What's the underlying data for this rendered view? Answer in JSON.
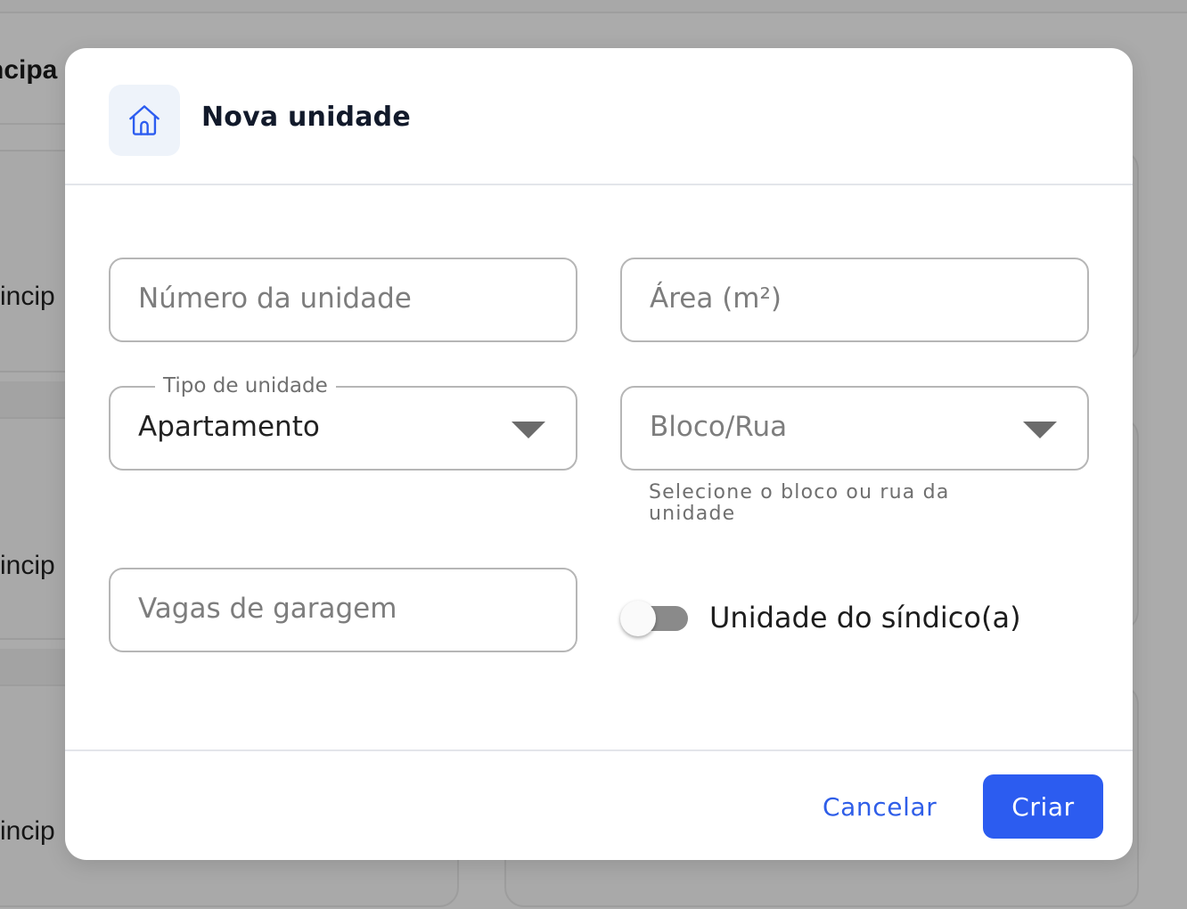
{
  "background": {
    "heading": "ncipa",
    "card_labels": [
      "rincip",
      "rincip",
      "rincip"
    ]
  },
  "modal": {
    "icon": "house-icon",
    "title": "Nova unidade",
    "fields": {
      "unit_number": {
        "placeholder": "Número da unidade"
      },
      "area": {
        "placeholder": "Área (m²)"
      },
      "unit_type": {
        "label": "Tipo de unidade",
        "value": "Apartamento"
      },
      "block": {
        "placeholder": "Bloco/Rua",
        "helper": "Selecione o bloco ou rua da unidade"
      },
      "parking": {
        "placeholder": "Vagas de garagem"
      }
    },
    "toggle": {
      "label": "Unidade do síndico(a)",
      "on": false
    },
    "footer": {
      "cancel_label": "Cancelar",
      "create_label": "Criar"
    }
  },
  "colors": {
    "primary": "#2c5cf0",
    "title": "#121a2b",
    "overlay": "#ababab"
  }
}
